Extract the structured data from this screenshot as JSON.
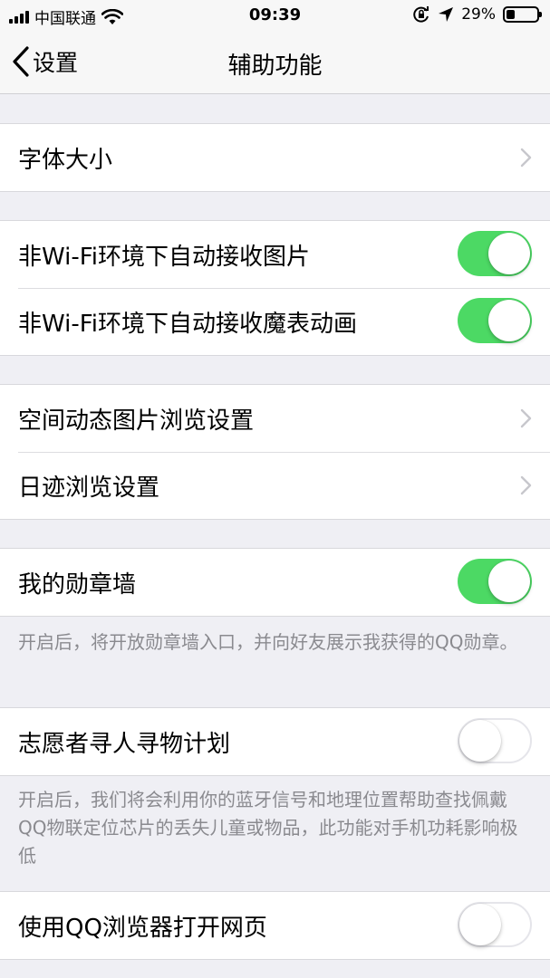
{
  "status_bar": {
    "carrier": "中国联通",
    "time": "09:39",
    "battery_percent": "29%",
    "battery_level": 0.29,
    "icons": [
      "signal-icon",
      "wifi-icon",
      "orientation-lock-icon",
      "location-arrow-icon",
      "battery-icon"
    ]
  },
  "nav": {
    "back_label": "设置",
    "title": "辅助功能"
  },
  "rows": {
    "font_size": {
      "label": "字体大小"
    },
    "auto_receive_images": {
      "label": "非Wi-Fi环境下自动接收图片",
      "enabled": true
    },
    "auto_receive_animations": {
      "label": "非Wi-Fi环境下自动接收魔表动画",
      "enabled": true
    },
    "qzone_image_settings": {
      "label": "空间动态图片浏览设置"
    },
    "footprint_settings": {
      "label": "日迹浏览设置"
    },
    "medal_wall": {
      "label": "我的勋章墙",
      "enabled": true,
      "footnote": "开启后，将开放勋章墙入口，并向好友展示我获得的QQ勋章。"
    },
    "volunteer_search": {
      "label": "志愿者寻人寻物计划",
      "enabled": false,
      "footnote": "开启后，我们将会利用你的蓝牙信号和地理位置帮助查找佩戴QQ物联定位芯片的丢失儿童或物品，此功能对手机功耗影响极低"
    },
    "qq_browser": {
      "label": "使用QQ浏览器打开网页",
      "enabled": false
    }
  },
  "colors": {
    "toggle_on": "#4cd964",
    "background": "#efeff4",
    "footnote_text": "#8a8a8f"
  }
}
